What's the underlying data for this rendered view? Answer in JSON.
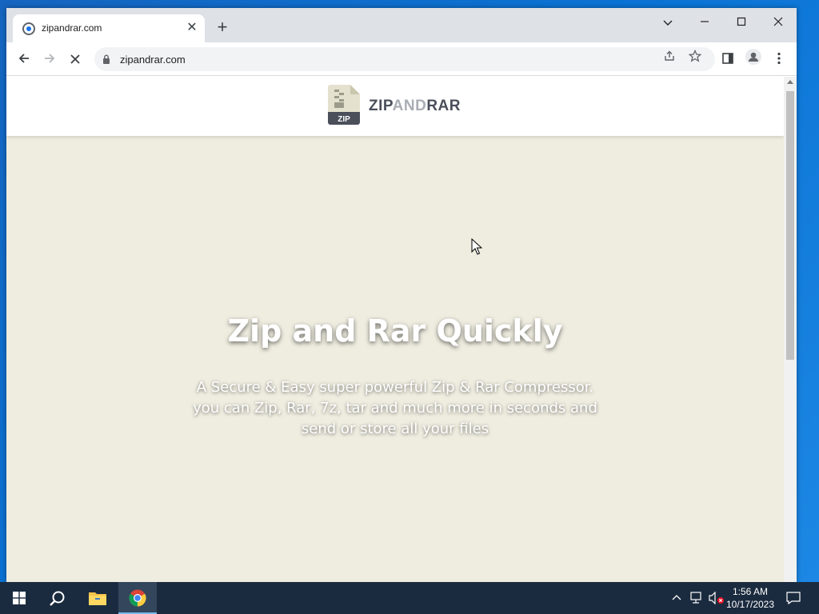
{
  "browser": {
    "tab_title": "zipandrar.com",
    "tab_close": "✕",
    "new_tab": "+",
    "url": "zipandrar.com"
  },
  "site": {
    "logo_badge": "ZIP",
    "logo_text_1": "ZIP",
    "logo_text_2": "AND",
    "logo_text_3": "RAR"
  },
  "hero": {
    "title": "Zip and Rar Quickly",
    "subtitle": "A Secure & Easy super powerful Zip & Rar Compressor. you can Zip, Rar, 7z, tar and much more in seconds and send or store all your files"
  },
  "taskbar": {
    "time": "1:56 AM",
    "date": "10/17/2023"
  },
  "colors": {
    "page_bg": "#efede0",
    "tabstrip": "#dee1e6",
    "taskbar": "#1b2b3f",
    "logo_dark": "#4a4f5a"
  }
}
